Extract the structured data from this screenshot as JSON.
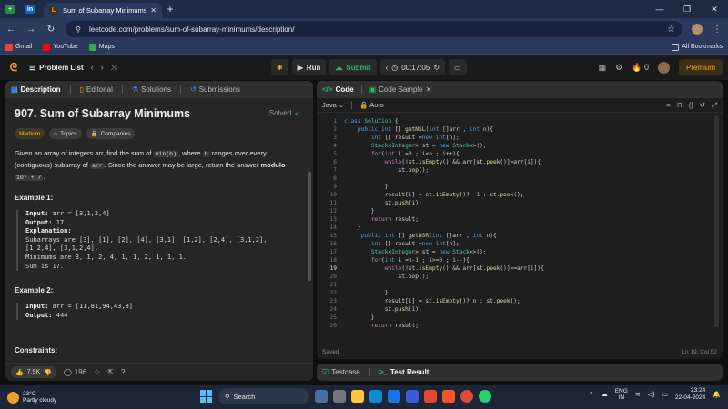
{
  "browser": {
    "tab_title": "Sum of Subarray Minimums - L",
    "url": "leetcode.com/problems/sum-of-subarray-minimums/description/",
    "bookmarks": [
      "Gmail",
      "YouTube",
      "Maps"
    ],
    "all_bookmarks": "All Bookmarks"
  },
  "topbar": {
    "problem_list": "Problem List",
    "run": "Run",
    "submit": "Submit",
    "timer": "00:17:05",
    "coins": "0",
    "premium": "Premium"
  },
  "left": {
    "tabs": [
      "Description",
      "Editorial",
      "Solutions",
      "Submissions"
    ],
    "title": "907. Sum of Subarray Minimums",
    "solved": "Solved",
    "tags": [
      "Medium",
      "Topics",
      "Companies"
    ],
    "desc1": "Given an array of integers arr, find the sum of ",
    "desc_code1": "min(b)",
    "desc2": ", where ",
    "desc_code2": "b",
    "desc3": " ranges over every (contiguous) subarray of ",
    "desc_code3": "arr",
    "desc4": ". Since the answer may be large, return the answer ",
    "desc_modulo": "modulo",
    "desc_code4": "10⁹ + 7",
    "desc5": ".",
    "example1_heading": "Example 1:",
    "example1_lines": [
      "Input: arr = [3,1,2,4]",
      "Output: 17",
      "Explanation:",
      "Subarrays are [3], [1], [2], [4], [3,1], [1,2], [2,4], [3,1,2],",
      "[1,2,4], [3,1,2,4].",
      "Minimums are 3, 1, 2, 4, 1, 1, 2, 1, 1, 1.",
      "Sum is 17."
    ],
    "example2_heading": "Example 2:",
    "example2_lines": [
      "Input: arr = [11,81,94,43,3]",
      "Output: 444"
    ],
    "constraints": "Constraints:",
    "likes": "7.9K",
    "comments": "196"
  },
  "right": {
    "tabs": [
      "Code",
      "Code Sample"
    ],
    "language": "Java",
    "mode": "Auto",
    "status": "Saved",
    "cursor": "Ln 19, Col 52",
    "code": [
      "class Solution {",
      "    public int [] getNSL(int []arr , int n){",
      "        int [] result =new int[n];",
      "        Stack<Integer> st = new Stack<>();",
      "        for(int i =0 ; i<n ; i++){",
      "            while(!st.isEmpty() && arr[st.peek()]>arr[i]){",
      "                st.pop();",
      "",
      "            }",
      "            result[i] = st.isEmpty()? -1 : st.peek();",
      "            st.push(i);",
      "        }",
      "        return result;",
      "    }",
      "     public int [] getNSR(int []arr , int n){",
      "        int [] result =new int[n];",
      "        Stack<Integer> st = new Stack<>();",
      "        for(int i =n-1 ; i>=0 ; i--){",
      "            while(!st.isEmpty() && arr[st.peek()]>=arr[i]){",
      "                st.pop();",
      "",
      "            }",
      "            result[i] = st.isEmpty()? n : st.peek();",
      "            st.push(i);",
      "        }",
      "        return result;"
    ],
    "console_tabs": [
      "Testcase",
      "Test Result"
    ]
  },
  "taskbar": {
    "temp": "23°C",
    "weather": "Partly cloudy",
    "search": "Search",
    "lang1": "ENG",
    "lang2": "IN",
    "time": "23:24",
    "date": "22-04-2024"
  }
}
